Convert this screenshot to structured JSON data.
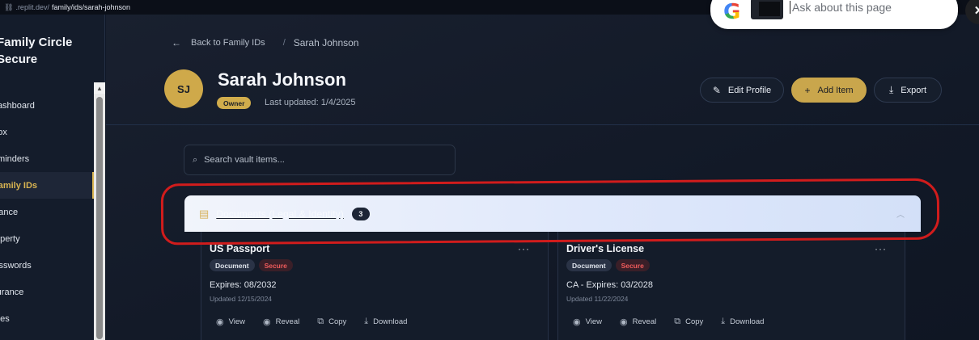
{
  "browser": {
    "url_domain": ".replit.dev/",
    "url_path": "family/ids/sarah-johnson"
  },
  "sidebar": {
    "brand_line1": "Family Circle",
    "brand_line2": "Secure",
    "items": [
      {
        "label": "Dashboard"
      },
      {
        "label": "Inbox"
      },
      {
        "label": "Reminders"
      },
      {
        "label": "Family IDs",
        "active": true
      },
      {
        "label": "Finance"
      },
      {
        "label": "Property"
      },
      {
        "label": "Passwords"
      },
      {
        "label": "Insurance"
      },
      {
        "label": "Notes"
      }
    ]
  },
  "breadcrumb": {
    "back_label": "Back to Family IDs",
    "separator": "/",
    "current": "Sarah Johnson"
  },
  "profile": {
    "initials": "SJ",
    "name": "Sarah Johnson",
    "role_badge": "Owner",
    "last_updated": "Last updated: 1/4/2025"
  },
  "actions": {
    "edit_label": "Edit Profile",
    "add_label": "Add Item",
    "export_label": "Export"
  },
  "search": {
    "placeholder": "Search vault items..."
  },
  "section": {
    "title": "Documents (Legal & Identity)",
    "count": "3"
  },
  "cards": [
    {
      "name": "US Passport",
      "tags": [
        "Document",
        "Secure"
      ],
      "expires": "Expires: 08/2032",
      "updated": "Updated 12/15/2024",
      "actions": [
        "View",
        "Reveal",
        "Copy",
        "Download"
      ]
    },
    {
      "name": "Driver's License",
      "tags": [
        "Document",
        "Secure"
      ],
      "expires": "CA - Expires: 03/2028",
      "updated": "Updated 11/22/2024",
      "actions": [
        "View",
        "Reveal",
        "Copy",
        "Download"
      ]
    }
  ],
  "overlay": {
    "google_prompt": "Ask about this page",
    "google_logo": "G",
    "close_symbol": "✕"
  },
  "colors": {
    "accent_gold": "#d1ad4c",
    "secure_red": "#ef5b5b",
    "highlight_red": "#d11c1c"
  }
}
